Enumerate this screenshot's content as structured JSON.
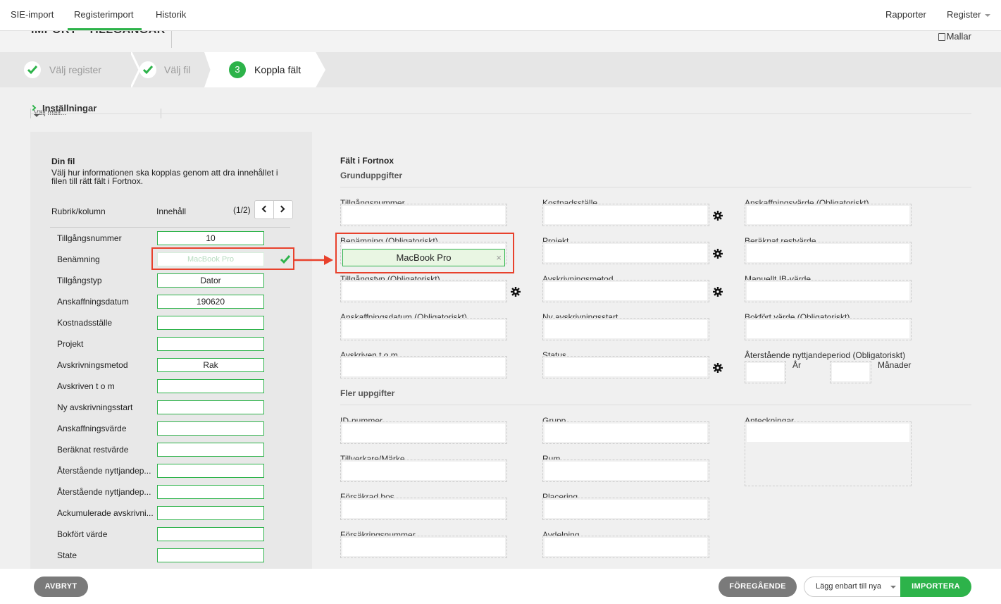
{
  "nav": {
    "tabs": [
      "SIE-import",
      "Registerimport",
      "Historik"
    ],
    "right": [
      "Rapporter",
      "Register"
    ]
  },
  "header": {
    "title": "IMPORT - TILLGÅNGAR",
    "templates": "Mallar"
  },
  "steps": [
    {
      "label": "Välj register",
      "status": "done"
    },
    {
      "label": "Välj fil",
      "status": "done"
    },
    {
      "number": "3",
      "label": "Koppla fält",
      "status": "active"
    }
  ],
  "settings": {
    "label": "Inställningar",
    "template_select": "Välj mall..."
  },
  "file_panel": {
    "title": "Din fil",
    "description": "Välj hur informationen ska kopplas genom att dra innehållet i filen till rätt fält i Fortnox.",
    "col_heading": "Rubrik/kolumn",
    "content_heading": "Innehåll",
    "page": "(1/2)",
    "rows": [
      {
        "label": "Tillgångsnummer",
        "value": "10"
      },
      {
        "label": "Benämning",
        "value": "MacBook Pro"
      },
      {
        "label": "Tillgångstyp",
        "value": "Dator"
      },
      {
        "label": "Anskaffningsdatum",
        "value": "190620"
      },
      {
        "label": "Kostnadsställe",
        "value": ""
      },
      {
        "label": "Projekt",
        "value": ""
      },
      {
        "label": "Avskrivningsmetod",
        "value": "Rak"
      },
      {
        "label": "Avskriven t o m",
        "value": ""
      },
      {
        "label": "Ny avskrivningsstart",
        "value": ""
      },
      {
        "label": "Anskaffningsvärde",
        "value": ""
      },
      {
        "label": "Beräknat restvärde",
        "value": ""
      },
      {
        "label": "Återstående nyttjandep...",
        "value": ""
      },
      {
        "label": "Återstående nyttjandep...",
        "value": ""
      },
      {
        "label": "Ackumulerade avskrivni...",
        "value": ""
      },
      {
        "label": "Bokfört värde",
        "value": ""
      },
      {
        "label": "State",
        "value": ""
      }
    ]
  },
  "fortnox": {
    "title": "Fält i Fortnox",
    "section1": "Grunduppgifter",
    "section2": "Fler uppgifter",
    "basic": {
      "col1": [
        "Tillgångsnummer",
        "Benämning (Obligatoriskt)",
        "Tillgångstyp (Obligatoriskt)",
        "Anskaffningsdatum (Obligatoriskt)",
        "Avskriven t o m"
      ],
      "col2": [
        "Kostnadsställe",
        "Projekt",
        "Avskrivningsmetod",
        "Ny avskrivningsstart",
        "Status"
      ],
      "col3": [
        "Anskaffningsvärde (Obligatoriskt)",
        "Beräknat restvärde",
        "Manuellt IB-värde",
        "Bokfört värde (Obligatoriskt)",
        "Återstående nyttjandeperiod (Obligatoriskt)"
      ]
    },
    "mapped_value": "MacBook Pro",
    "clear_symbol": "×",
    "years_label": "År",
    "months_label": "Månader",
    "more": {
      "col1": [
        "ID-nummer",
        "Tillverkare/Märke",
        "Försäkrad hos",
        "Försäkringsnummer"
      ],
      "col2": [
        "Grupp",
        "Rum",
        "Placering",
        "Avdelning"
      ],
      "col3": [
        "Anteckningar"
      ]
    }
  },
  "footer": {
    "cancel": "AVBRYT",
    "previous": "FÖREGÅENDE",
    "import_mode": "Lägg enbart till nya",
    "import": "IMPORTERA"
  },
  "colors": {
    "accent": "#2db34a",
    "highlight": "#e8412c"
  }
}
